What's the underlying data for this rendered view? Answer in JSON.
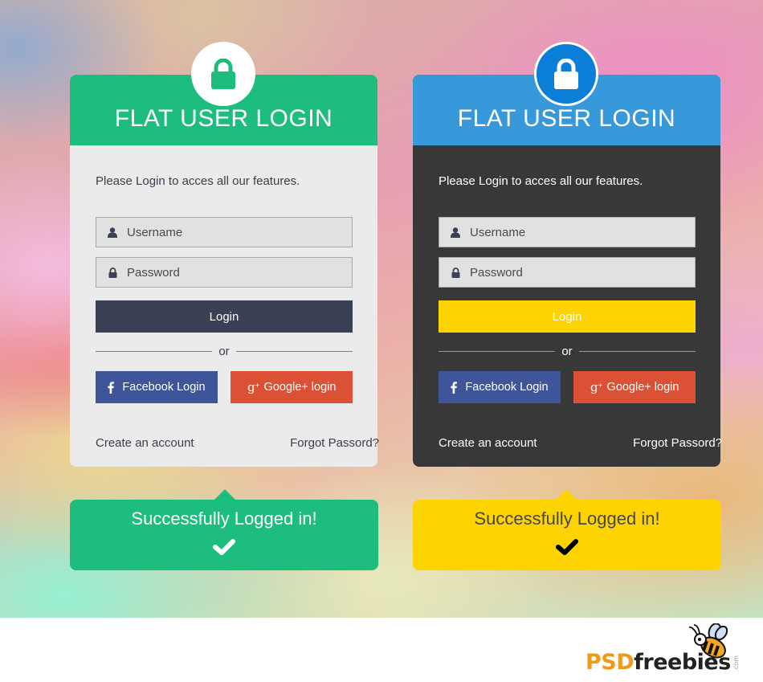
{
  "colors": {
    "green": "#1dbd7e",
    "blue": "#3899da",
    "lock_blue": "#0b7ed7",
    "navy_button": "#3a4055",
    "yellow": "#fdd402",
    "facebook": "#3f5599",
    "google": "#da5135",
    "light_card": "#ebebeb",
    "dark_card": "#383838"
  },
  "cards": [
    {
      "theme": "light",
      "header_icon": "lock-icon",
      "title": "FLAT USER LOGIN",
      "intro": "Please Login to acces all our features.",
      "username_placeholder": "Username",
      "password_placeholder": "Password",
      "login_label": "Login",
      "or_label": "or",
      "facebook_label": "Facebook Login",
      "google_label": "Google+ login",
      "create_account": "Create an account",
      "forgot_password": "Forgot Passord?"
    },
    {
      "theme": "dark",
      "header_icon": "lock-icon",
      "title": "FLAT USER LOGIN",
      "intro": "Please Login to acces all our features.",
      "username_placeholder": "Username",
      "password_placeholder": "Password",
      "login_label": "Login",
      "or_label": "or",
      "facebook_label": "Facebook Login",
      "google_label": "Google+ login",
      "create_account": "Create an account",
      "forgot_password": "Forgot Passord?"
    }
  ],
  "toasts": [
    {
      "message": "Successfully Logged in!",
      "icon": "checkmark-icon"
    },
    {
      "message": "Successfully Logged in!",
      "icon": "checkmark-icon"
    }
  ],
  "footer": {
    "logo_psd": "PSD",
    "logo_freebies": "freebies",
    "logo_com": ".com"
  }
}
